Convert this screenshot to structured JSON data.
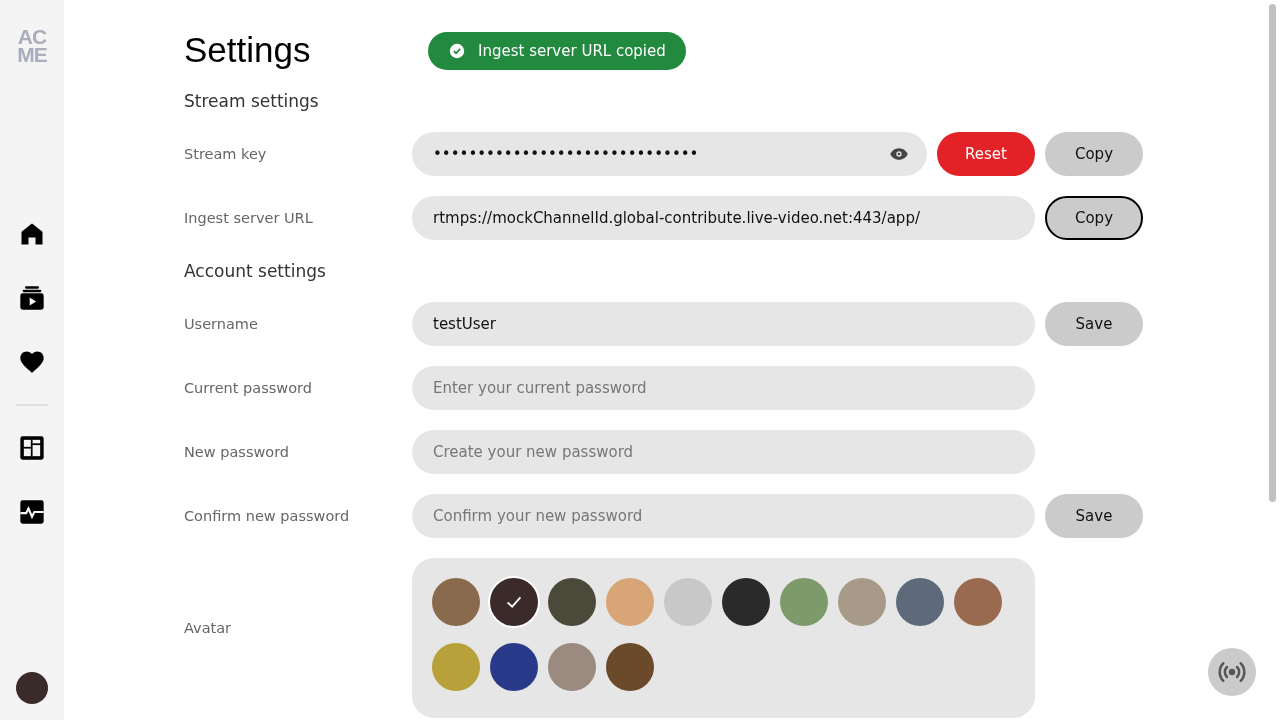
{
  "sidebar": {
    "logo": [
      "AC",
      "ME"
    ],
    "items": [
      {
        "kind": "home"
      },
      {
        "kind": "video"
      },
      {
        "kind": "heart"
      },
      {
        "kind": "divider"
      },
      {
        "kind": "dashboard"
      },
      {
        "kind": "activity"
      }
    ]
  },
  "toast": {
    "text": "Ingest server URL copied"
  },
  "page_title": "Settings",
  "sections": [
    {
      "title": "Stream settings",
      "rows": [
        {
          "label": "Stream key",
          "value": "••••••••••••••••••••••••••••••",
          "reveal": true,
          "buttons": [
            {
              "label": "Reset",
              "kind": "danger",
              "focused": false
            },
            {
              "label": "Copy",
              "kind": "plain",
              "focused": false
            }
          ]
        },
        {
          "label": "Ingest server URL",
          "value": "rtmps://mockChannelId.global-contribute.live-video.net:443/app/",
          "buttons": [
            {
              "label": "Copy",
              "kind": "plain",
              "focused": true
            }
          ]
        }
      ]
    },
    {
      "title": "Account settings",
      "rows": [
        {
          "label": "Username",
          "value": "testUser",
          "buttons": [
            {
              "label": "Save",
              "kind": "plain",
              "focused": false
            }
          ]
        },
        {
          "label": "Current password",
          "placeholder": "Enter your current password",
          "buttons": []
        },
        {
          "label": "New password",
          "placeholder": "Create your new password",
          "buttons": []
        },
        {
          "label": "Confirm new password",
          "placeholder": "Confirm your new password",
          "buttons": [
            {
              "label": "Save",
              "kind": "plain",
              "focused": false
            }
          ]
        }
      ]
    }
  ],
  "avatar": {
    "label": "Avatar",
    "options": [
      {
        "selected": false,
        "color": "#8a6a4c"
      },
      {
        "selected": true,
        "color": "#3a2a2a"
      },
      {
        "selected": false,
        "color": "#4b4a3a"
      },
      {
        "selected": false,
        "color": "#d8a676"
      },
      {
        "selected": false,
        "color": "#c8c8c8"
      },
      {
        "selected": false,
        "color": "#2a2a2a"
      },
      {
        "selected": false,
        "color": "#7c9a6a"
      },
      {
        "selected": false,
        "color": "#a89a88"
      },
      {
        "selected": false,
        "color": "#5e6a7a"
      },
      {
        "selected": false,
        "color": "#9a6a50"
      },
      {
        "selected": false,
        "color": "#b8a03a"
      },
      {
        "selected": false,
        "color": "#2a3a8a"
      },
      {
        "selected": false,
        "color": "#9a8a80"
      },
      {
        "selected": false,
        "color": "#6a4a2a"
      }
    ]
  }
}
